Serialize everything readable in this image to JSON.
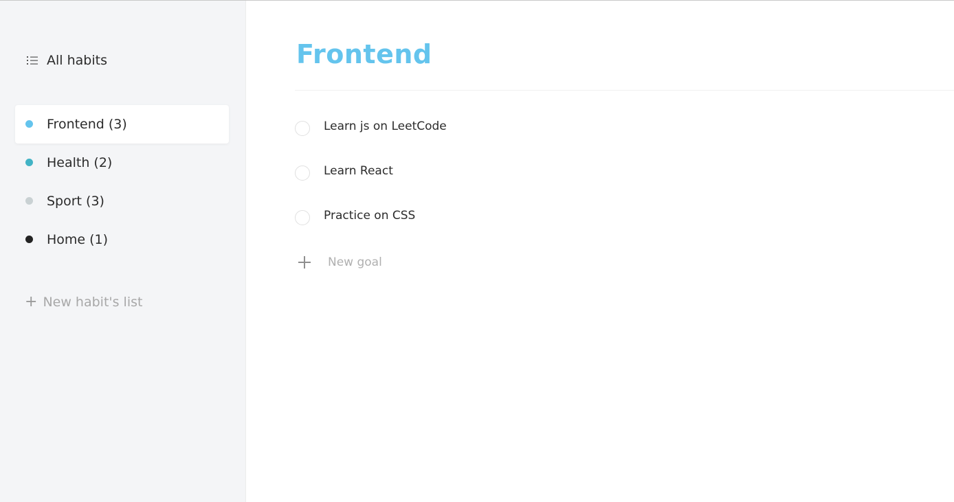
{
  "sidebar": {
    "all_habits": {
      "icon": "list-icon",
      "label": "All habits"
    },
    "lists": [
      {
        "label": "Frontend (3)",
        "color": "#64c4ed",
        "active": true
      },
      {
        "label": "Health (2)",
        "color": "#42b3c5",
        "active": false
      },
      {
        "label": "Sport (3)",
        "color": "#c9d1d3",
        "active": false
      },
      {
        "label": "Home (1)",
        "color": "#232323",
        "active": false
      }
    ],
    "new_list": {
      "icon": "plus-icon",
      "label": "New habit's list"
    }
  },
  "main": {
    "title": "Frontend",
    "title_color": "#64c4ed",
    "tasks": [
      {
        "label": "Learn js on LeetCode",
        "done": false
      },
      {
        "label": "Learn React",
        "done": false
      },
      {
        "label": "Practice on CSS",
        "done": false
      }
    ],
    "new_goal": {
      "icon": "plus-icon",
      "placeholder": "New goal"
    }
  }
}
